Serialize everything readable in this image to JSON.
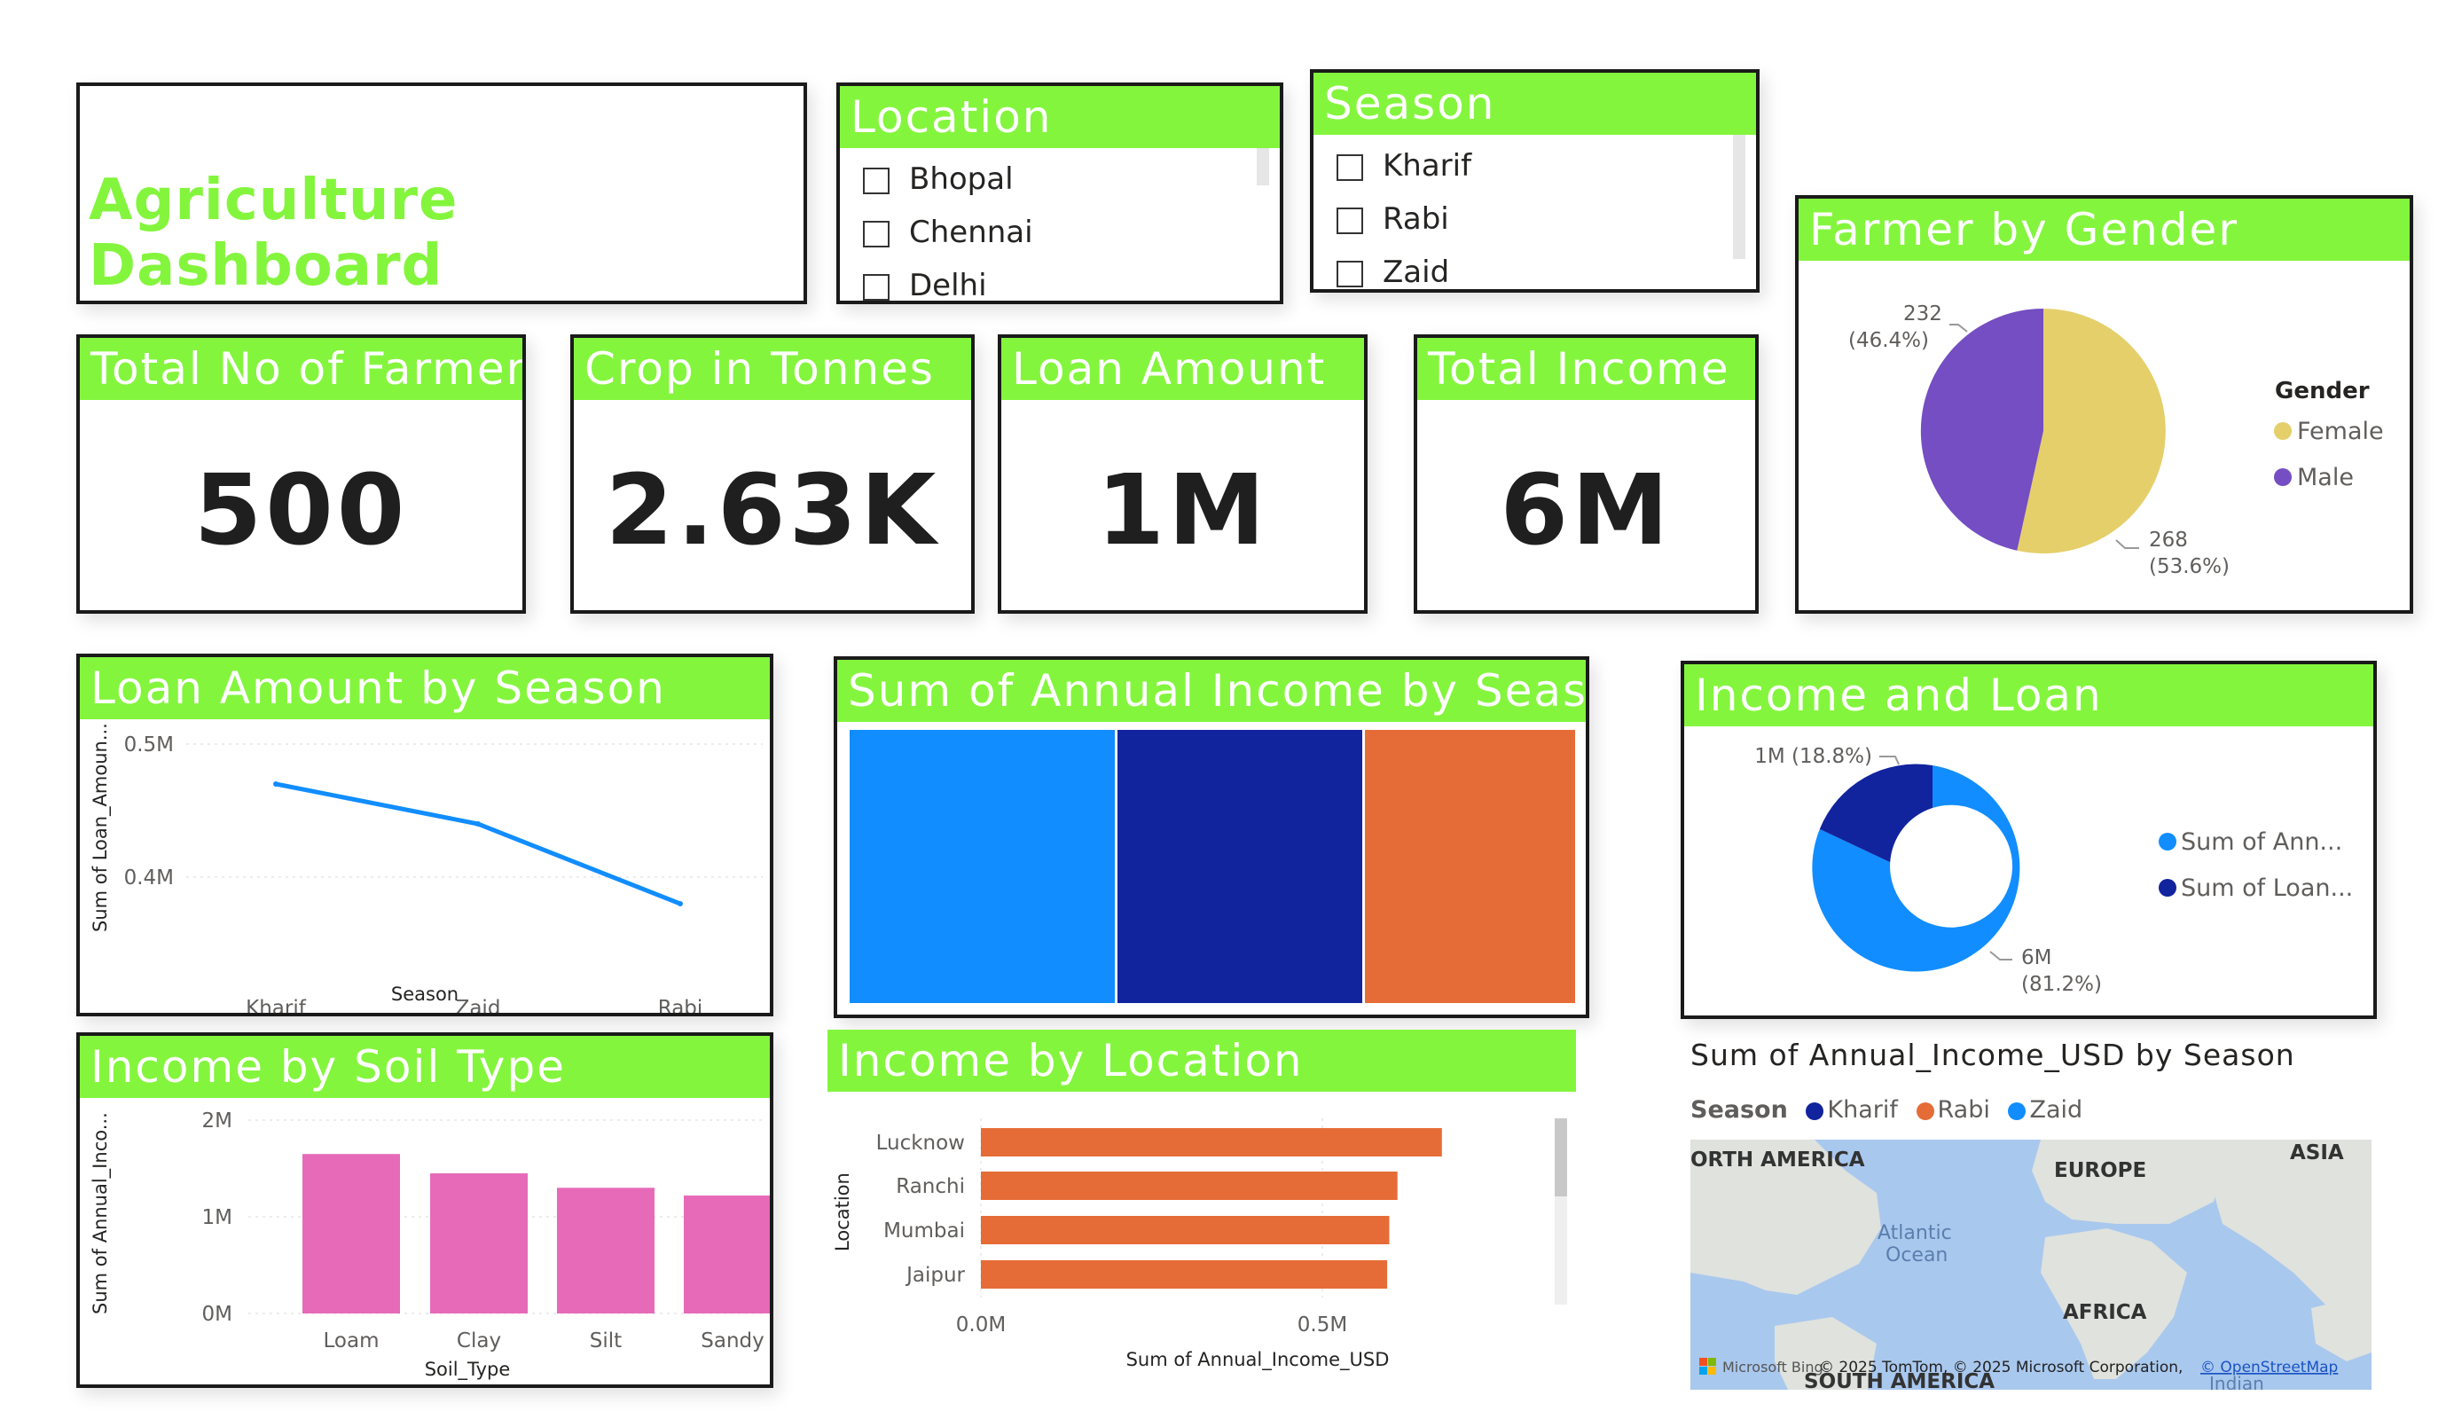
{
  "title": "Agriculture Dashboard",
  "colors": {
    "header_green": "#84f53d",
    "blue": "#118dff",
    "navy": "#12239e",
    "orange": "#e66c37",
    "pink": "#e66ab8",
    "female": "#e5cf6b",
    "male": "#744ec2"
  },
  "slicers": {
    "location": {
      "title": "Location",
      "items": [
        "Bhopal",
        "Chennai",
        "Delhi"
      ]
    },
    "season": {
      "title": "Season",
      "items": [
        "Kharif",
        "Rabi",
        "Zaid"
      ]
    }
  },
  "kpis": {
    "farmers": {
      "title": "Total No of Farmers",
      "value": "500"
    },
    "crop": {
      "title": "Crop in Tonnes",
      "value": "2.63K"
    },
    "loan": {
      "title": "Loan Amount",
      "value": "1M"
    },
    "income": {
      "title": "Total Income",
      "value": "6M"
    }
  },
  "gender_chart": {
    "title": "Farmer by Gender",
    "legend_title": "Gender",
    "female_label": "Female",
    "male_label": "Male",
    "male_value": "232",
    "male_pct": "(46.4%)",
    "female_value": "268",
    "female_pct": "(53.6%)"
  },
  "loan_season": {
    "title": "Loan Amount by Season",
    "ylabel": "Sum of Loan_Amoun...",
    "xlabel": "Season",
    "yticks": [
      "0.5M",
      "0.4M"
    ],
    "categories": [
      "Kharif",
      "Zaid",
      "Rabi"
    ]
  },
  "income_season": {
    "title": "Sum of Annual Income by Season"
  },
  "income_loan": {
    "title": "Income and Loan",
    "loan_label": "1M (18.8%)",
    "income_value": "6M",
    "income_pct": "(81.2%)",
    "legend_income": "Sum of Ann...",
    "legend_loan": "Sum of Loan..."
  },
  "soil": {
    "title": "Income by Soil Type",
    "ylabel": "Sum of Annual_Inco...",
    "xlabel": "Soil_Type",
    "yticks": [
      "2M",
      "1M",
      "0M"
    ],
    "categories": [
      "Loam",
      "Clay",
      "Silt",
      "Sandy"
    ]
  },
  "location_chart": {
    "title": "Income by Location",
    "ylabel": "Location",
    "xlabel": "Sum of Annual_Income_USD",
    "xticks": [
      "0.0M",
      "0.5M"
    ],
    "categories": [
      "Lucknow",
      "Ranchi",
      "Mumbai",
      "Jaipur"
    ]
  },
  "map": {
    "title": "Sum of Annual_Income_USD by Season",
    "legend_title": "Season",
    "legend": [
      "Kharif",
      "Rabi",
      "Zaid"
    ],
    "labels": {
      "north_america": "ORTH AMERICA",
      "europe": "EUROPE",
      "asia": "ASIA",
      "atlantic1": "Atlantic",
      "atlantic2": "Ocean",
      "africa": "AFRICA",
      "south_america": "SOUTH AMERICA",
      "indian": "Indian"
    },
    "attribution_bing": "Microsoft Bing",
    "attribution": "© 2025 TomTom, © 2025 Microsoft Corporation,",
    "attribution_link": "© OpenStreetMap"
  },
  "chart_data": [
    {
      "type": "pie",
      "title": "Farmer by Gender",
      "categories": [
        "Female",
        "Male"
      ],
      "values": [
        268,
        232
      ],
      "colors": [
        "#e5cf6b",
        "#744ec2"
      ]
    },
    {
      "type": "line",
      "title": "Loan Amount by Season",
      "categories": [
        "Kharif",
        "Zaid",
        "Rabi"
      ],
      "values": [
        0.47,
        0.44,
        0.38
      ],
      "ylim": [
        0.35,
        0.5
      ],
      "ylabel": "Sum of Loan_Amoun...",
      "xlabel": "Season"
    },
    {
      "type": "treemap",
      "title": "Sum of Annual Income by Season",
      "categories": [
        "Kharif",
        "Rabi",
        "Zaid"
      ],
      "values": [
        2.27,
        2.1,
        1.73
      ],
      "colors": [
        "#118dff",
        "#12239e",
        "#e66c37"
      ]
    },
    {
      "type": "pie",
      "title": "Income and Loan",
      "categories": [
        "Sum of Annual_Income_USD",
        "Sum of Loan_Amount"
      ],
      "values": [
        6,
        1
      ],
      "percents": [
        81.2,
        18.8
      ],
      "colors": [
        "#118dff",
        "#12239e"
      ]
    },
    {
      "type": "bar",
      "title": "Income by Soil Type",
      "categories": [
        "Loam",
        "Clay",
        "Silt",
        "Sandy"
      ],
      "values": [
        1.65,
        1.45,
        1.3,
        1.22
      ],
      "ylim": [
        0,
        2
      ],
      "ylabel": "Sum of Annual_Inco...",
      "xlabel": "Soil_Type"
    },
    {
      "type": "bar",
      "orientation": "horizontal",
      "title": "Income by Location",
      "categories": [
        "Lucknow",
        "Ranchi",
        "Mumbai",
        "Jaipur"
      ],
      "values": [
        0.675,
        0.61,
        0.598,
        0.595
      ],
      "xlim": [
        0,
        0.75
      ],
      "xlabel": "Sum of Annual_Income_USD",
      "ylabel": "Location"
    }
  ]
}
